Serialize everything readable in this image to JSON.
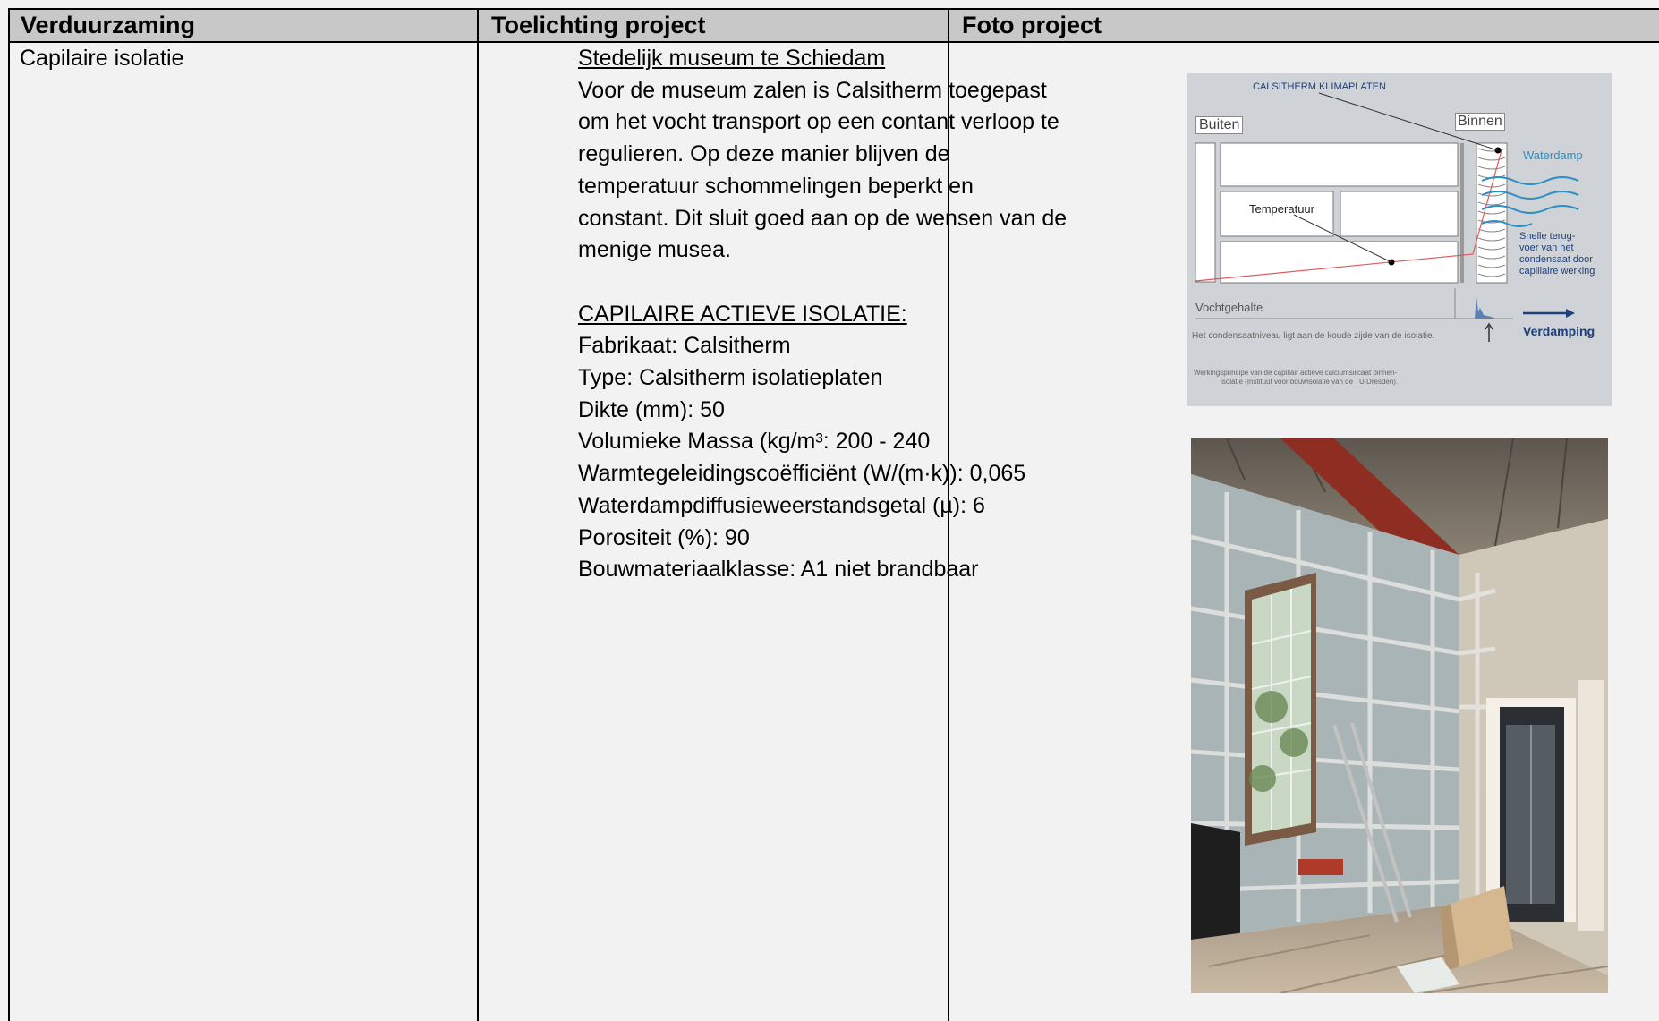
{
  "headers": {
    "col1": "Verduurzaming",
    "col2": "Toelichting project",
    "col3": "Foto project"
  },
  "col1_text": "Capilaire isolatie",
  "project": {
    "title": "Stedelijk museum te Schiedam",
    "description_lines": [
      "Voor de museum zalen is Calsitherm toegepast",
      "om het vocht transport op een contant verloop te",
      "regulieren. Op deze manier blijven de",
      "temperatuur schommelingen beperkt en",
      "constant. Dit sluit goed aan op de wensen van de",
      "menige musea."
    ],
    "spec_heading": "CAPILAIRE ACTIEVE ISOLATIE:",
    "specs": [
      "Fabrikaat: Calsitherm",
      "Type: Calsitherm isolatieplaten",
      "Dikte (mm): 50",
      "Volumieke Massa (kg/m³: 200 - 240",
      "Warmtegeleidingscoëfficiënt (W/(m·k)): 0,065",
      "Waterdampdiffusieweerstandsgetal (µ): 6",
      "Porositeit (%): 90",
      "Bouwmateriaalklasse: A1 niet brandbaar"
    ]
  },
  "diagram": {
    "title": "CALSITHERM KLIMAPLATEN",
    "outside": "Buiten",
    "inside": "Binnen",
    "vapor": "Waterdamp",
    "temperature": "Temperatuur",
    "capillary": [
      "Snelle terug-",
      "voer van het",
      "condensaat door",
      "capillaire werking"
    ],
    "moisture": "Vochtgehalte",
    "condensate_note": "Het condensaatniveau ligt aan de koude zijde van de isolatie.",
    "evaporation": "Verdamping",
    "caption": [
      "Werkingsprincipe van de capillair actieve calciumsilicaat binnen-",
      "isolatie (Instituut voor bouwisolatie van de TU Dresden)."
    ]
  },
  "colors": {
    "header_bg": "#c8c8c8",
    "page_bg": "#f2f2f2",
    "diagram_bg": "#cfd2d6",
    "vapor_blue": "#2a8fc7",
    "evaporation_navy": "#1f3f7a"
  },
  "photo": {
    "description_icon": "construction-site-photo"
  }
}
